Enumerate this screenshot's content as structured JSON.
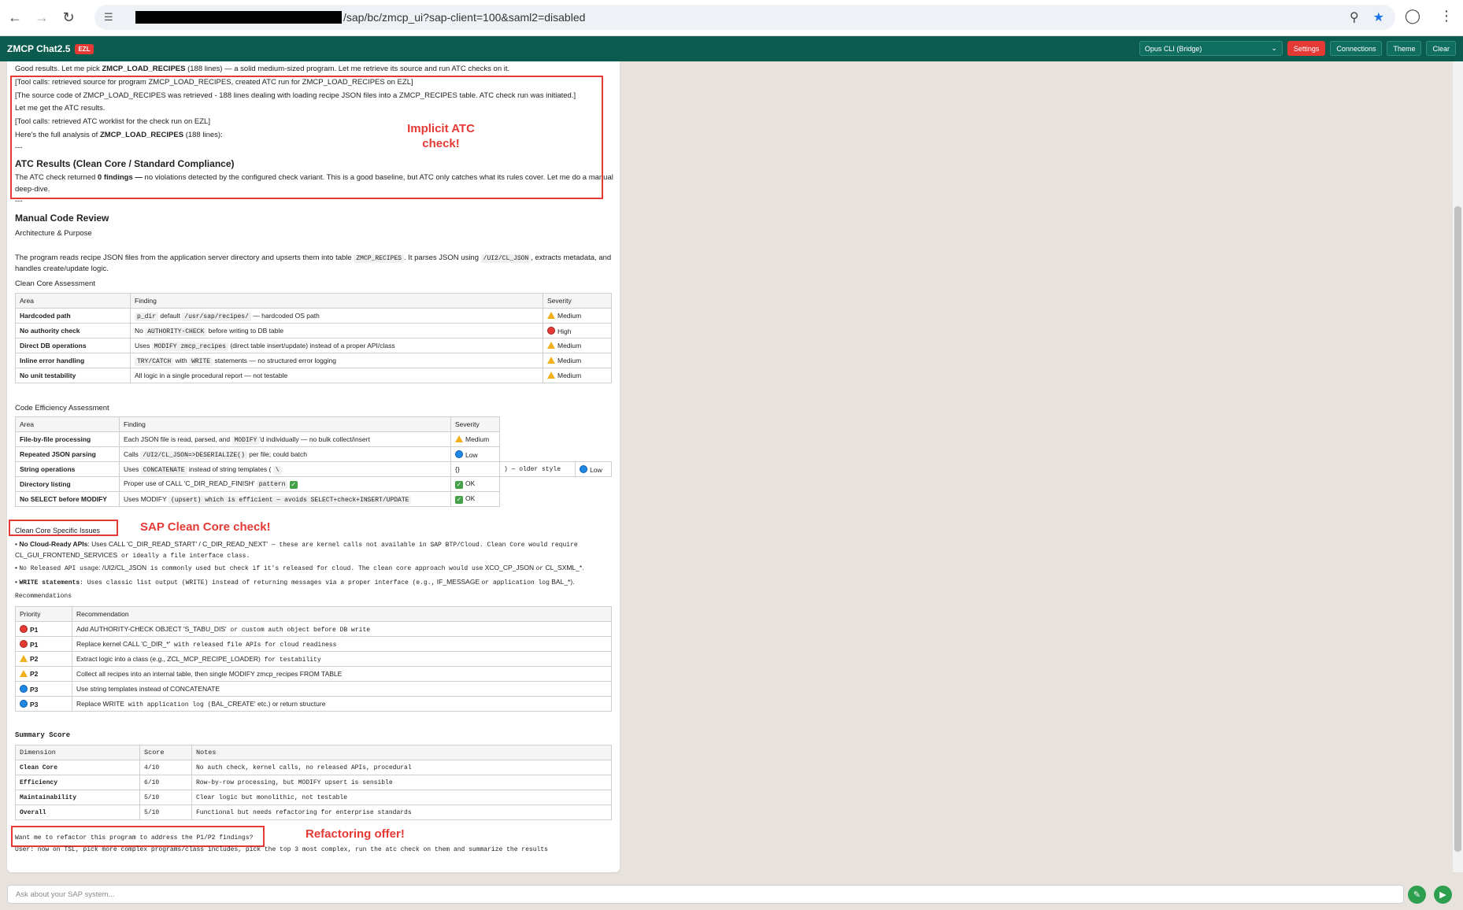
{
  "browser": {
    "url": "/sap/bc/zmcp_ui?sap-client=100&saml2=disabled",
    "back_icon": "arrow-left-icon",
    "forward_icon": "arrow-right-icon",
    "reload_icon": "reload-icon"
  },
  "header": {
    "title": "ZMCP Chat2.5",
    "env": "EZL",
    "model": "Opus CLI (Bridge)",
    "buttons": [
      "Settings",
      "Connections",
      "Theme",
      "Clear"
    ]
  },
  "chat": {
    "intro_pre": "Good results. Let me pick ",
    "intro_bold": "ZMCP_LOAD_RECIPES",
    "intro_post": " (188 lines) — a solid medium-sized program. Let me retrieve its source and run ATC checks on it.",
    "tool1": "[Tool calls: retrieved source for program ZMCP_LOAD_RECIPES, created ATC run for ZMCP_LOAD_RECIPES on EZL]",
    "tool1_result": "[The source code of ZMCP_LOAD_RECIPES was retrieved - 188 lines dealing with loading recipe JSON files into a ZMCP_RECIPES table. ATC check run was initiated.]",
    "get_results": "Let me get the ATC results.",
    "tool2": "[Tool calls: retrieved ATC worklist for the check run on EZL]",
    "analysis_pre": "Here's the full analysis of ",
    "analysis_bold": "ZMCP_LOAD_RECIPES",
    "analysis_post": " (188 lines):",
    "sep1": "---",
    "atc_heading": "ATC Results (Clean Core / Standard Compliance)",
    "atc_pre": "The ATC check returned ",
    "atc_bold": "0 findings —",
    "atc_post": " no violations detected by the configured check variant. This is a good baseline, but ATC only catches what its rules cover. Let me do a manual",
    "atc_post2": "deep-dive.",
    "sep2": "---",
    "manual_heading": "Manual Code Review",
    "arch_heading": "Architecture & Purpose",
    "arch_text_pre": "The program reads recipe JSON files from the application server directory and upserts them into table ",
    "arch_code1": "ZMCP_RECIPES",
    "arch_text_mid": ". It parses JSON using ",
    "arch_code2": "/UI2/CL_JSON",
    "arch_text_post": ", extracts metadata, and",
    "arch_text_line2": "handles create/update logic.",
    "clean_core_heading": "Clean Core Assessment",
    "clean_core_table": {
      "headers": [
        "Area",
        "Finding",
        "Severity"
      ],
      "rows": [
        {
          "area": "Hardcoded path",
          "finding_code": "p_dir",
          "finding_mid": " default ",
          "finding_code2": "/usr/sap/recipes/",
          "finding_post": " — hardcoded OS path",
          "severity": "Medium",
          "icon": "warn"
        },
        {
          "area": "No authority check",
          "finding_pre": "No ",
          "finding_code": "AUTHORITY-CHECK",
          "finding_post": " before writing to DB table",
          "severity": "High",
          "icon": "red"
        },
        {
          "area": "Direct DB operations",
          "finding_pre": "Uses ",
          "finding_code": "MODIFY zmcp_recipes",
          "finding_post": " (direct table insert/update) instead of a proper API/class",
          "severity": "Medium",
          "icon": "warn"
        },
        {
          "area": "Inline error handling",
          "finding_code": "TRY/CATCH",
          "finding_mid": " with ",
          "finding_code2": "WRITE",
          "finding_post": " statements — no structured error logging",
          "severity": "Medium",
          "icon": "warn"
        },
        {
          "area": "No unit testability",
          "finding_post": "All logic in a single procedural report — not testable",
          "severity": "Medium",
          "icon": "warn"
        }
      ]
    },
    "efficiency_heading": "Code Efficiency Assessment",
    "efficiency_table": {
      "headers": [
        "Area",
        "Finding",
        "Severity"
      ],
      "rows": [
        {
          "area": "File-by-file processing",
          "finding": "Each JSON file is read, parsed, and ",
          "code": "MODIFY",
          "finding_post": "'d individually — no bulk collect/insert",
          "severity": "Medium",
          "icon": "warn"
        },
        {
          "area": "Repeated JSON parsing",
          "finding": "Calls ",
          "code": "/UI2/CL_JSON=>DESERIALIZE()",
          "finding_post": " per file; could batch",
          "severity": "Low",
          "icon": "blue"
        },
        {
          "area": "String operations",
          "finding": "Uses ",
          "code": "CONCATENATE",
          "finding_post": " instead of string templates ( ",
          "code2": "\\",
          "extra1": "{}",
          "extra2": ") — older style",
          "severity": "Low",
          "icon": "blue"
        },
        {
          "area": "Directory listing",
          "finding": "Proper use of CALL 'C_DIR_READ_FINISH'",
          "code": "pattern",
          "finding_post": "",
          "severity": "OK",
          "icon": "ok"
        },
        {
          "area": "No SELECT before MODIFY",
          "finding": "Uses MODIFY ",
          "code": "(upsert) which is efficient — avoids SELECT+check+INSERT/UPDATE",
          "finding_post": "",
          "severity": "OK",
          "icon": "ok"
        }
      ]
    },
    "specific_heading": "Clean Core Specific Issues",
    "bullets": [
      {
        "bold": "No Cloud-Ready APIs",
        "pre": ": Uses CALL 'C_DIR_READ_START' / C_DIR_READ_NEXT'",
        "code": " — these are kernel calls not available in SAP BTP/Cloud. Clean Core would require",
        "line2_pre": "CL_GUI_FRONTEND_SERVICES",
        "line2_code": " or ideally a file interface class."
      },
      {
        "bold": "No Released API usage",
        "pre": ": /UI2/CL_JSON",
        "code": " is commonly used but check if it's released for cloud. The clean core approach would use",
        "post": " XCO_CP_JSON ",
        "code2": "or",
        "post2": " CL_SXML_*."
      },
      {
        "bold": "WRITE statements",
        "pre": "",
        "code": ": Uses classic list output (WRITE) instead of returning messages via a proper interface (e.g.,",
        "post": " IF_MESSAGE ",
        "code2": "or application log",
        "post2": " BAL_*)."
      }
    ],
    "recommendations_heading": "Recommendations",
    "rec_table": {
      "headers": [
        "Priority",
        "Recommendation"
      ],
      "rows": [
        {
          "priority": "P1",
          "icon": "red",
          "rec": "Add AUTHORITY-CHECK OBJECT 'S_TABU_DIS'",
          "code": " or custom auth object before DB write"
        },
        {
          "priority": "P1",
          "icon": "red",
          "rec": "Replace kernel CALL 'C_DIR_*'",
          "code": " with released file APIs for cloud readiness"
        },
        {
          "priority": "P2",
          "icon": "warn",
          "rec": "Extract logic into a class (e.g., ZCL_MCP_RECIPE_LOADER)",
          "code": " for testability"
        },
        {
          "priority": "P2",
          "icon": "warn",
          "rec": "Collect all recipes into an internal table, then single MODIFY zmcp_recipes FROM TABLE",
          "code": ""
        },
        {
          "priority": "P3",
          "icon": "blue",
          "rec": "Use string templates instead of CONCATENATE",
          "code": ""
        },
        {
          "priority": "P3",
          "icon": "blue",
          "rec": "Replace WRITE",
          "code": " with application log (",
          "post": "BAL_CREATE' etc.) or return structure"
        }
      ]
    },
    "summary_heading": "Summary Score",
    "summary_table": {
      "headers": [
        "Dimension",
        "Score",
        "Notes"
      ],
      "rows": [
        {
          "dim": "Clean Core",
          "score": "4/10",
          "notes": "No auth check, kernel calls, no released APIs, procedural"
        },
        {
          "dim": "Efficiency",
          "score": "6/10",
          "notes": "Row-by-row processing, but MODIFY upsert is sensible"
        },
        {
          "dim": "Maintainability",
          "score": "5/10",
          "notes": "Clear logic but monolithic, not testable"
        },
        {
          "dim": "Overall",
          "score": "5/10",
          "notes": "Functional but needs refactoring for enterprise standards"
        }
      ]
    },
    "refactor_question": "Want me to refactor this program to address the P1/P2 findings?",
    "user_msg": "User: now on TSL, pick more complex programs/class includes, pick the top 3 most complex, run the atc check on them and summarize the results"
  },
  "annotations": {
    "implicit_atc": "Implicit ATC check!",
    "clean_core_check": "SAP Clean Core check!",
    "refactoring": "Refactoring offer!"
  },
  "input": {
    "placeholder": "Ask about your SAP system..."
  }
}
